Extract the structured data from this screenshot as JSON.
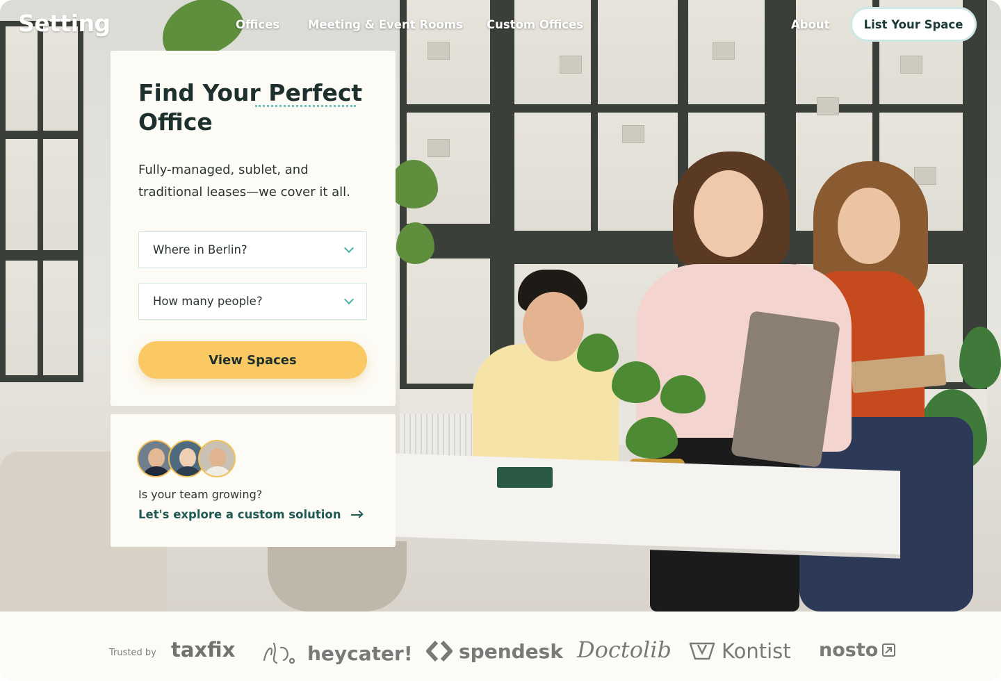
{
  "nav": {
    "logo": "Setting",
    "links": [
      "Offices",
      "Meeting & Event Rooms",
      "Custom Offices",
      "About"
    ],
    "cta": "List Your Space"
  },
  "search_card": {
    "headline_line1": "Find Your Perfect",
    "headline_line2": "Office",
    "subtext": "Fully-managed, sublet, and traditional leases—we cover it all.",
    "location_select": "Where in Berlin?",
    "people_select": "How many people?",
    "submit": "View Spaces"
  },
  "team_card": {
    "question": "Is your team growing?",
    "link": "Let's explore a custom solution"
  },
  "trust_bar": {
    "label": "Trusted by",
    "brands": [
      "taxfix",
      "heycater!",
      "spendesk",
      "Doctolib",
      "Kontist",
      "nosto"
    ]
  },
  "colors": {
    "accent_yellow": "#fbc964",
    "accent_teal": "#4fb0a8",
    "heading": "#1d302d",
    "link": "#1f5a55"
  },
  "icons": [
    "chevron-down-icon",
    "arrow-right-icon"
  ]
}
